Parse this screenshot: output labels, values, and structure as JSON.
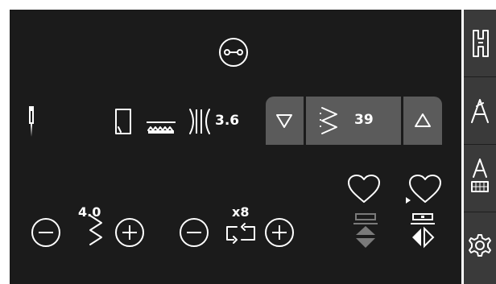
{
  "settings": {
    "width_value": "3.6",
    "stitch_width": "4.0",
    "repeat_count": "x8"
  },
  "stitch_selector": {
    "stitch_number": "39",
    "prev_icon": "triangle-down-icon",
    "next_icon": "triangle-up-icon"
  },
  "icons": {
    "buttonhole": "buttonhole-icon",
    "needle": "needle-icon",
    "presser_foot": "presser-foot-icon",
    "feed_dogs": "feed-dogs-icon",
    "stitch_width_gap": "stitch-width-gap-icon",
    "favorite": "heart-icon",
    "minus": "minus-circle-icon",
    "plus": "plus-circle-icon",
    "zigzag": "zigzag-icon",
    "repeat": "repeat-icon",
    "mirror": "mirror-icon",
    "sidebar": [
      "presser-foot-menu-icon",
      "font-a-icon",
      "font-keyboard-icon",
      "gear-icon"
    ]
  },
  "colors": {
    "screen_bg": "#1b1b1b",
    "panel": "#5b5b5b",
    "sidebar": "#3a3a3a",
    "foreground": "#ffffff",
    "disabled": "#7a7a7a"
  }
}
